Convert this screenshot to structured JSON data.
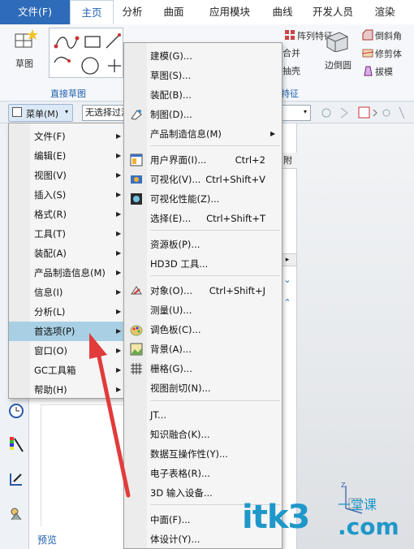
{
  "tabs": {
    "file": "文件(F)",
    "home": "主页",
    "analysis": "分析",
    "surface": "曲面",
    "app_module": "应用模块",
    "curve": "曲线",
    "developer": "开发人员",
    "render": "渲染"
  },
  "ribbon": {
    "sketch_label": "草图",
    "direct_sketch_group": "直接草图",
    "array_feature": "阵列特征",
    "merge": "合并",
    "shell": "抽壳",
    "edge_round": "边倒圆",
    "chamfer": "倒斜角",
    "trim_body": "修剪体",
    "draft": "拔模",
    "feature_group": "特征"
  },
  "toolbar": {
    "menu_label": "菜单(M)",
    "filter_text": "无选择过滤器"
  },
  "nav": {
    "col_header": "附",
    "preview_label": "预览"
  },
  "main_menu": {
    "items": [
      {
        "label": "文件(F)"
      },
      {
        "label": "编辑(E)"
      },
      {
        "label": "视图(V)"
      },
      {
        "label": "插入(S)"
      },
      {
        "label": "格式(R)"
      },
      {
        "label": "工具(T)"
      },
      {
        "label": "装配(A)"
      },
      {
        "label": "产品制造信息(M)"
      },
      {
        "label": "信息(I)"
      },
      {
        "label": "分析(L)"
      },
      {
        "label": "首选项(P)"
      },
      {
        "label": "窗口(O)"
      },
      {
        "label": "GC工具箱"
      },
      {
        "label": "帮助(H)"
      }
    ]
  },
  "sub_menu": {
    "items": [
      {
        "label": "建模(G)...",
        "shortcut": ""
      },
      {
        "label": "草图(S)...",
        "shortcut": ""
      },
      {
        "label": "装配(B)...",
        "shortcut": ""
      },
      {
        "label": "制图(D)...",
        "shortcut": ""
      },
      {
        "label": "产品制造信息(M)",
        "shortcut": ""
      },
      {
        "label": "用户界面(I)...",
        "shortcut": "Ctrl+2"
      },
      {
        "label": "可视化(V)...",
        "shortcut": "Ctrl+Shift+V"
      },
      {
        "label": "可视化性能(Z)...",
        "shortcut": ""
      },
      {
        "label": "选择(E)...",
        "shortcut": "Ctrl+Shift+T"
      },
      {
        "label": "资源板(P)...",
        "shortcut": ""
      },
      {
        "label": "HD3D 工具...",
        "shortcut": ""
      },
      {
        "label": "对象(O)...",
        "shortcut": "Ctrl+Shift+J"
      },
      {
        "label": "测量(U)...",
        "shortcut": ""
      },
      {
        "label": "调色板(C)...",
        "shortcut": ""
      },
      {
        "label": "背景(A)...",
        "shortcut": ""
      },
      {
        "label": "栅格(G)...",
        "shortcut": ""
      },
      {
        "label": "视图剖切(N)...",
        "shortcut": ""
      },
      {
        "label": "JT...",
        "shortcut": ""
      },
      {
        "label": "知识融合(K)...",
        "shortcut": ""
      },
      {
        "label": "数据互操作性(Y)...",
        "shortcut": ""
      },
      {
        "label": "电子表格(R)...",
        "shortcut": ""
      },
      {
        "label": "3D 输入设备...",
        "shortcut": ""
      },
      {
        "label": "中面(F)...",
        "shortcut": ""
      },
      {
        "label": "体设计(Y)...",
        "shortcut": ""
      }
    ]
  },
  "watermark": {
    "logo": "itk3",
    "site": ".com",
    "tag": "一堂课"
  },
  "colors": {
    "accent": "#2e6bb8",
    "highlight": "#a9cfe4",
    "arrow": "#e23b3b"
  }
}
